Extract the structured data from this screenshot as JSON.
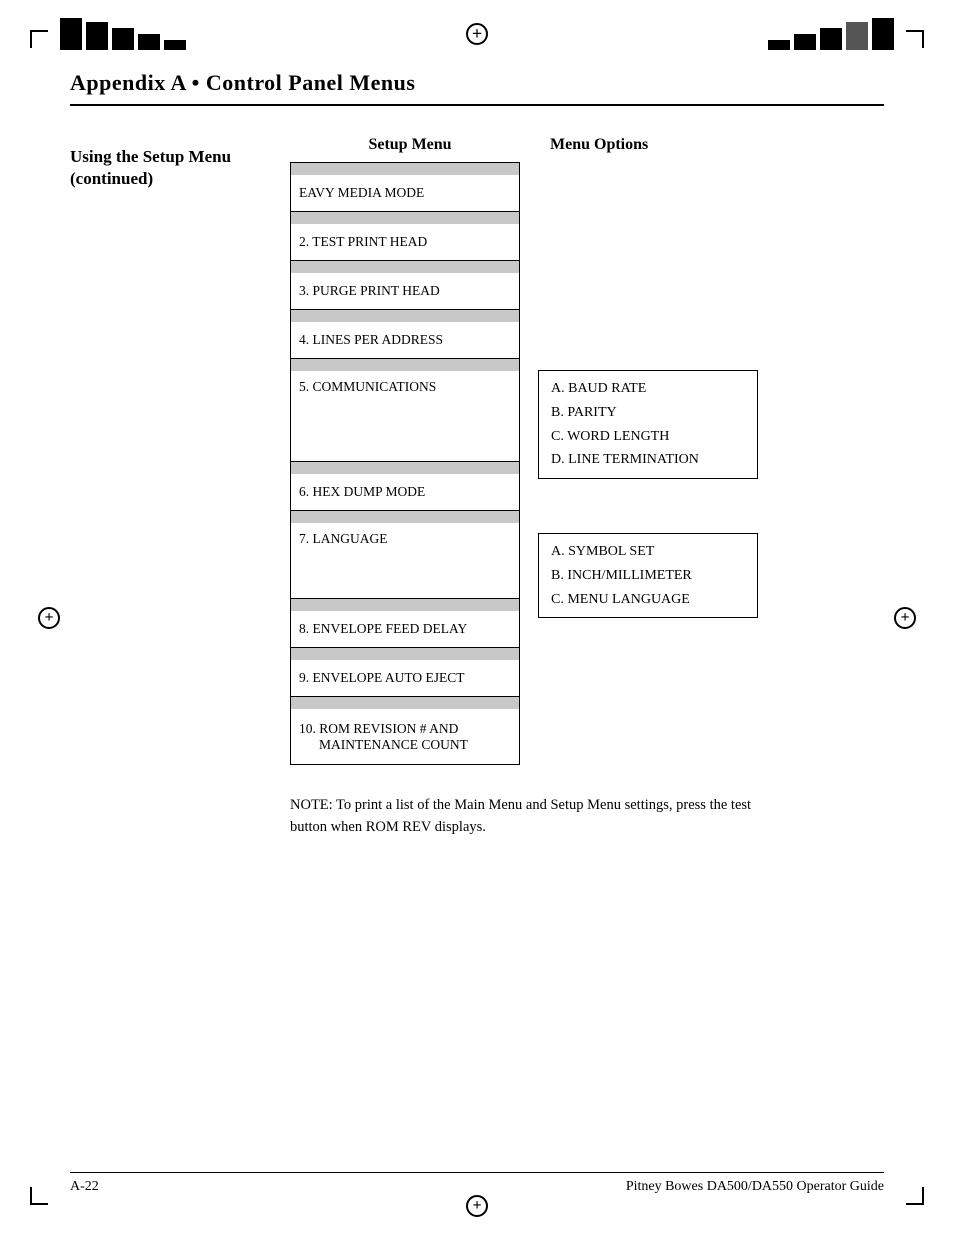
{
  "page": {
    "title": "Appendix A  •  Control Panel Menus",
    "footer_left": "A-22",
    "footer_right": "Pitney Bowes DA500/DA550 Operator Guide"
  },
  "sidebar": {
    "title": "Using the Setup Menu (continued)"
  },
  "columns": {
    "setup_menu_label": "Setup Menu",
    "menu_options_label": "Menu Options"
  },
  "menu_items": [
    {
      "id": "item0",
      "text": "EAVY MEDIA MODE",
      "gray": false
    },
    {
      "id": "item1",
      "text": "2.  TEST PRINT HEAD",
      "gray": false
    },
    {
      "id": "item2",
      "text": "3.  PURGE PRINT HEAD",
      "gray": false
    },
    {
      "id": "item3",
      "text": "4.  LINES PER ADDRESS",
      "gray": false
    },
    {
      "id": "item4",
      "text": "5.  COMMUNICATIONS",
      "gray": false,
      "has_options": true
    },
    {
      "id": "item5",
      "text": "6.  HEX DUMP MODE",
      "gray": false
    },
    {
      "id": "item6",
      "text": "7.  LANGUAGE",
      "gray": false,
      "has_options": true
    },
    {
      "id": "item7",
      "text": "8.  ENVELOPE FEED DELAY",
      "gray": false
    },
    {
      "id": "item8",
      "text": "9.  ENVELOPE AUTO EJECT",
      "gray": false
    },
    {
      "id": "item9",
      "text": "10. ROM REVISION # AND\n    MAINTENANCE COUNT",
      "gray": false,
      "double": true
    }
  ],
  "communications_options": [
    "A.  BAUD RATE",
    "B.  PARITY",
    "C.  WORD LENGTH",
    "D.  LINE TERMINATION"
  ],
  "language_options": [
    "A.  SYMBOL SET",
    "B.  INCH/MILLIMETER",
    "C.  MENU LANGUAGE"
  ],
  "note": {
    "text": "NOTE: To print a list of the Main Menu and Setup Menu settings, press the test button when ROM REV displays."
  }
}
